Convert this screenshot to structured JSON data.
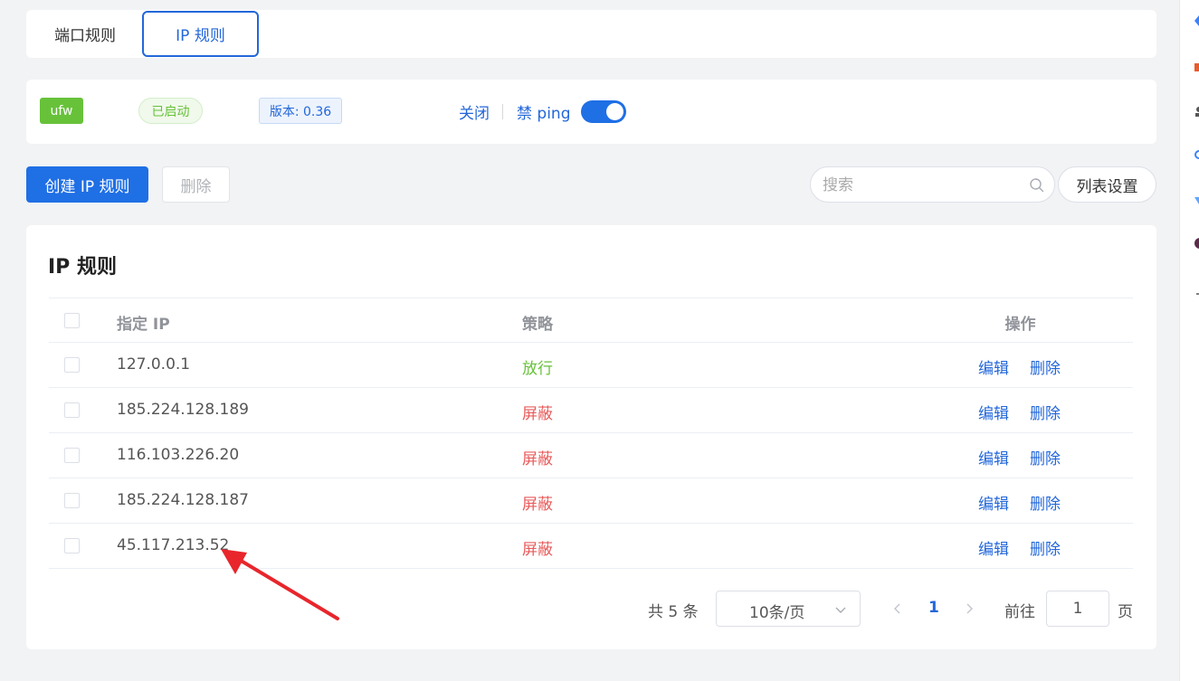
{
  "tabs": [
    {
      "label": "端口规则",
      "active": false
    },
    {
      "label": "IP 规则",
      "active": true
    }
  ],
  "status": {
    "firewall_tag": "ufw",
    "state_tag": "已启动",
    "version_tag": "版本: 0.36",
    "close_link": "关闭",
    "ping_link": "禁 ping",
    "ping_switch_on": true
  },
  "toolbar": {
    "create_label": "创建 IP 规则",
    "delete_label": "删除",
    "search_placeholder": "搜索",
    "list_settings_label": "列表设置"
  },
  "table": {
    "title": "IP 规则",
    "columns": {
      "ip": "指定 IP",
      "policy": "策略",
      "ops": "操作"
    },
    "rows": [
      {
        "ip": "127.0.0.1",
        "policy": "放行",
        "edit": "编辑",
        "delete": "删除"
      },
      {
        "ip": "185.224.128.189",
        "policy": "屏蔽",
        "edit": "编辑",
        "delete": "删除"
      },
      {
        "ip": "116.103.226.20",
        "policy": "屏蔽",
        "edit": "编辑",
        "delete": "删除"
      },
      {
        "ip": "185.224.128.187",
        "policy": "屏蔽",
        "edit": "编辑",
        "delete": "删除"
      },
      {
        "ip": "45.117.213.52",
        "policy": "屏蔽",
        "edit": "编辑",
        "delete": "删除"
      }
    ]
  },
  "pagination": {
    "total_text": "共 5 条",
    "page_size": "10条/页",
    "current_page": "1",
    "goto_label": "前往",
    "goto_value": "1",
    "page_unit": "页"
  },
  "colors": {
    "primary": "#1f6fe5",
    "allow": "#67c23a",
    "block": "#e85c5c",
    "annotation_arrow": "#e8262c"
  }
}
